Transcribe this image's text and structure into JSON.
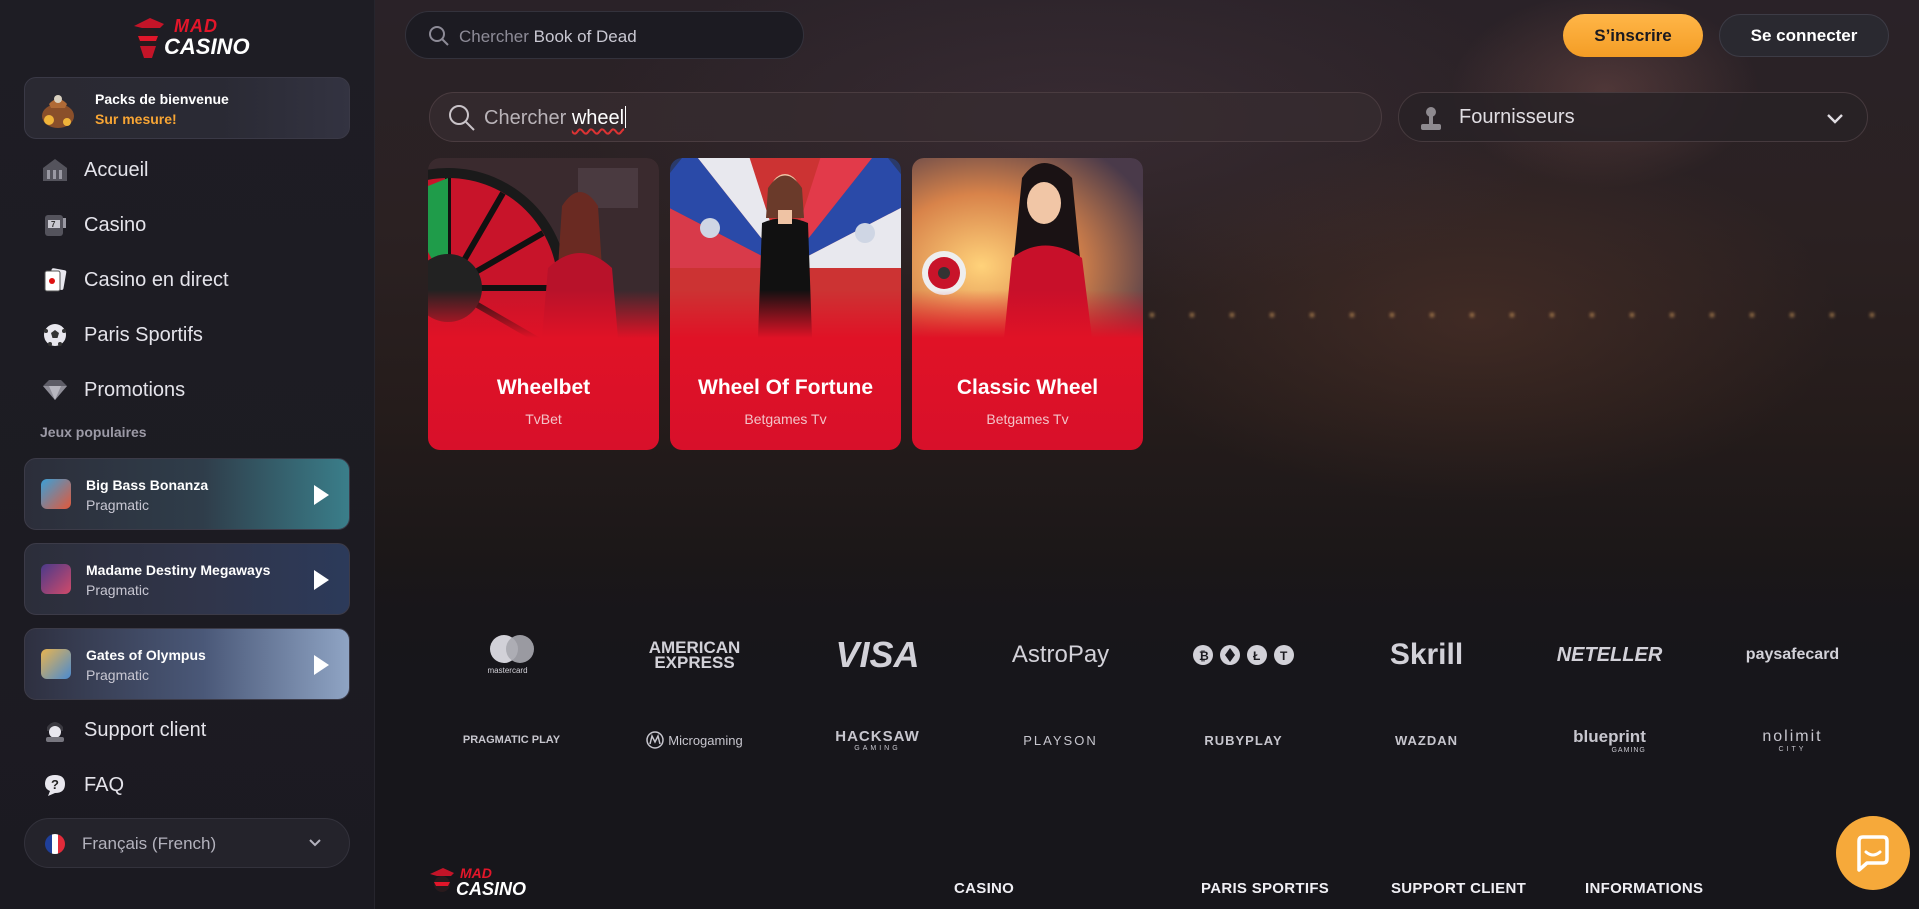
{
  "brand": {
    "logo_top": "MAD",
    "logo_bottom": "CASINO"
  },
  "welcome": {
    "title": "Packs de bienvenue",
    "subtitle": "Sur mesure!"
  },
  "nav": [
    {
      "label": "Accueil",
      "icon": "home-icon"
    },
    {
      "label": "Casino",
      "icon": "slot-machine-icon"
    },
    {
      "label": "Casino en direct",
      "icon": "cards-icon"
    },
    {
      "label": "Paris Sportifs",
      "icon": "soccer-ball-icon"
    },
    {
      "label": "Promotions",
      "icon": "diamond-icon"
    }
  ],
  "popular": {
    "title": "Jeux populaires",
    "games": [
      {
        "name": "Big Bass Bonanza",
        "provider": "Pragmatic"
      },
      {
        "name": "Madame Destiny Megaways",
        "provider": "Pragmatic"
      },
      {
        "name": "Gates of Olympus",
        "provider": "Pragmatic"
      }
    ]
  },
  "support": {
    "support_label": "Support client",
    "faq_label": "FAQ"
  },
  "language": {
    "selected": "Français (French)"
  },
  "header": {
    "search_prefix": "Chercher",
    "search_example": "Book of Dead",
    "signup_label": "S’inscrire",
    "login_label": "Se connecter"
  },
  "search": {
    "prefix": "Chercher",
    "value": "wheel"
  },
  "providers_filter": {
    "label": "Fournisseurs"
  },
  "results": [
    {
      "title": "Wheelbet",
      "provider": "TvBet"
    },
    {
      "title": "Wheel Of Fortune",
      "provider": "Betgames Tv"
    },
    {
      "title": "Classic Wheel",
      "provider": "Betgames Tv"
    }
  ],
  "payments": [
    "mastercard",
    "AMERICAN EXPRESS",
    "VISA",
    "AstroPay",
    "crypto",
    "Skrill",
    "NETELLER",
    "paysafecard"
  ],
  "game_providers": [
    "PRAGMATIC PLAY",
    "Microgaming",
    "HACKSAW",
    "PLAYSON",
    "RUBYPLAY",
    "WAZDAN",
    "blueprint",
    "nolimit"
  ],
  "provider_subtitles": {
    "hacksaw": "GAMING",
    "blueprint": "GAMING",
    "nolimit": "CITY"
  },
  "footer": {
    "columns": [
      "CASINO",
      "PARIS SPORTIFS",
      "SUPPORT CLIENT",
      "INFORMATIONS"
    ]
  },
  "colors": {
    "accent": "#f7a534",
    "brand_red": "#e3162a",
    "card_red": "#e01226"
  }
}
